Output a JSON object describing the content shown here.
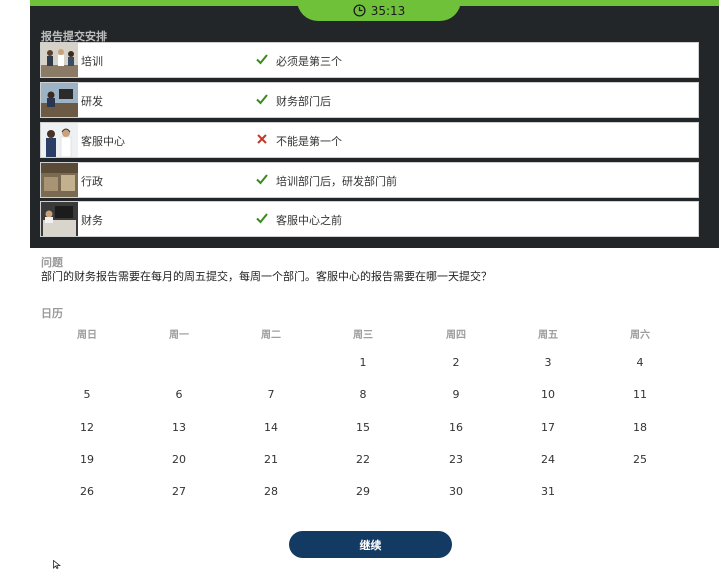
{
  "timer": {
    "value": "35:13",
    "icon": "clock-icon"
  },
  "schedule": {
    "title": "报告提交安排",
    "rows": [
      {
        "dept": "培训",
        "status": "check",
        "rule": "必须是第三个"
      },
      {
        "dept": "研发",
        "status": "check",
        "rule": "财务部门后"
      },
      {
        "dept": "客服中心",
        "status": "cross",
        "rule": "不能是第一个"
      },
      {
        "dept": "行政",
        "status": "check",
        "rule": "培训部门后，研发部门前"
      },
      {
        "dept": "财务",
        "status": "check",
        "rule": "客服中心之前"
      }
    ]
  },
  "question": {
    "label": "问题",
    "text": "部门的财务报告需要在每月的周五提交，每周一个部门。客服中心的报告需要在哪一天提交？"
  },
  "calendar": {
    "label": "日历",
    "weekdays": [
      "周日",
      "周一",
      "周二",
      "周三",
      "周四",
      "周五",
      "周六"
    ],
    "weeks": [
      [
        "",
        "",
        "",
        "1",
        "2",
        "3",
        "4"
      ],
      [
        "5",
        "6",
        "7",
        "8",
        "9",
        "10",
        "11"
      ],
      [
        "12",
        "13",
        "14",
        "15",
        "16",
        "17",
        "18"
      ],
      [
        "19",
        "20",
        "21",
        "22",
        "23",
        "24",
        "25"
      ],
      [
        "26",
        "27",
        "28",
        "29",
        "30",
        "31",
        ""
      ]
    ]
  },
  "continue_label": "继续",
  "colors": {
    "accent_green": "#6fc13a",
    "panel_dark": "#222629",
    "check_green": "#3a8a1e",
    "cross_red": "#c0392b",
    "button_navy": "#123a63"
  }
}
